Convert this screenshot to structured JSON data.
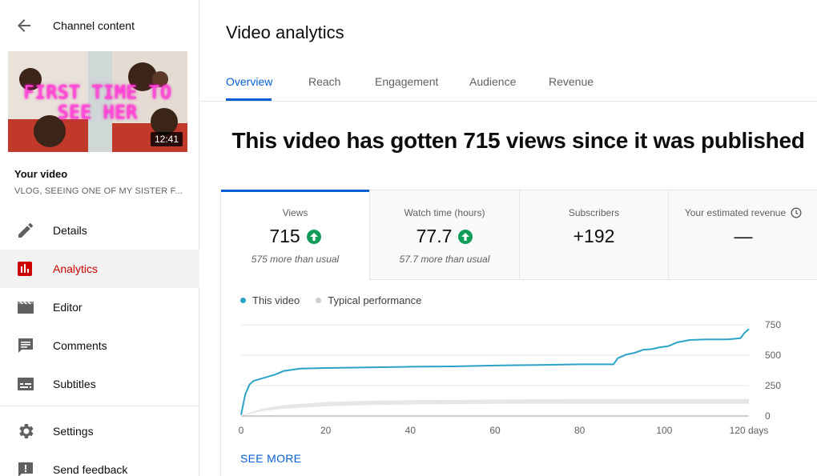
{
  "sidebar": {
    "header_title": "Channel content",
    "thumbnail": {
      "overlay_text": "FIRST TIME TO SEE HER",
      "duration": "12:41"
    },
    "your_video_label": "Your video",
    "video_title": "VLOG, SEEING ONE OF MY SISTER F...",
    "items": [
      {
        "label": "Details",
        "icon": "pencil-icon"
      },
      {
        "label": "Analytics",
        "icon": "analytics-icon",
        "active": true
      },
      {
        "label": "Editor",
        "icon": "clapperboard-icon"
      },
      {
        "label": "Comments",
        "icon": "comment-icon"
      },
      {
        "label": "Subtitles",
        "icon": "subtitles-icon"
      },
      {
        "label": "Settings",
        "icon": "gear-icon"
      },
      {
        "label": "Send feedback",
        "icon": "feedback-icon"
      }
    ]
  },
  "main": {
    "title": "Video analytics",
    "tabs": [
      {
        "label": "Overview",
        "active": true
      },
      {
        "label": "Reach"
      },
      {
        "label": "Engagement"
      },
      {
        "label": "Audience"
      },
      {
        "label": "Revenue"
      }
    ],
    "headline": "This video has gotten 715 views since it was published",
    "metrics": [
      {
        "label": "Views",
        "value": "715",
        "sub": "575 more than usual",
        "trend": "up"
      },
      {
        "label": "Watch time (hours)",
        "value": "77.7",
        "sub": "57.7 more than usual",
        "trend": "up"
      },
      {
        "label": "Subscribers",
        "value": "+192",
        "sub": ""
      },
      {
        "label": "Your estimated revenue",
        "value": "—",
        "sub": ""
      }
    ],
    "see_more": "SEE MORE"
  },
  "colors": {
    "accent": "#065fd4",
    "active_nav": "#cc0000",
    "series": "#2aa3c7",
    "typical": "#cccccc",
    "up": "#0f9d58"
  },
  "chart_data": {
    "type": "line",
    "legend": [
      "This video",
      "Typical performance"
    ],
    "x_ticks": [
      "0",
      "20",
      "40",
      "60",
      "80",
      "100",
      "120 days"
    ],
    "y_ticks": [
      "750",
      "500",
      "250",
      "0"
    ],
    "xlim": [
      0,
      120
    ],
    "ylim": [
      0,
      750
    ],
    "series": [
      {
        "name": "This video",
        "x": [
          0,
          1,
          2,
          3,
          5,
          8,
          10,
          14,
          20,
          30,
          40,
          50,
          60,
          70,
          80,
          88,
          89,
          91,
          93,
          95,
          97,
          99,
          101,
          103,
          106,
          110,
          115,
          118,
          119,
          120
        ],
        "y": [
          10,
          180,
          260,
          290,
          310,
          340,
          370,
          390,
          395,
          400,
          405,
          408,
          415,
          420,
          425,
          425,
          475,
          505,
          520,
          545,
          550,
          565,
          575,
          605,
          625,
          630,
          630,
          640,
          685,
          715
        ]
      },
      {
        "name": "Typical performance",
        "x": [
          0,
          5,
          10,
          20,
          30,
          40,
          60,
          80,
          100,
          120
        ],
        "y_low": [
          0,
          40,
          60,
          80,
          90,
          95,
          100,
          100,
          100,
          100
        ],
        "y_high": [
          5,
          60,
          90,
          115,
          125,
          130,
          135,
          140,
          140,
          140
        ]
      }
    ]
  }
}
